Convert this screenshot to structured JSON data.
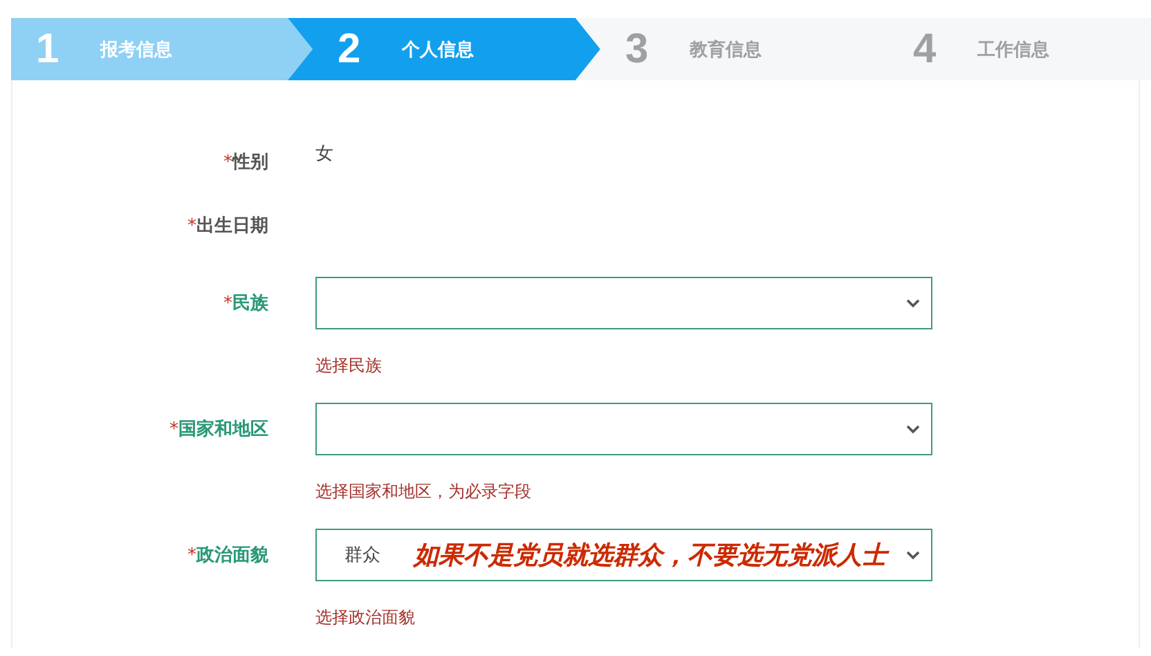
{
  "steps": [
    {
      "number": "1",
      "label": "报考信息",
      "completed": true,
      "selected": false
    },
    {
      "number": "2",
      "label": "个人信息",
      "completed": false,
      "selected": true
    },
    {
      "number": "3",
      "label": "教育信息",
      "completed": false,
      "selected": false
    },
    {
      "number": "4",
      "label": "工作信息",
      "completed": false,
      "selected": false
    }
  ],
  "fields": [
    {
      "label": "性别",
      "marker": "*",
      "kind": "static",
      "value": "女"
    },
    {
      "label": "出生日期",
      "marker": "*",
      "kind": "static"
    },
    {
      "label": "民族",
      "marker": "*",
      "kind": "select",
      "hint": "选择民族"
    },
    {
      "label": "国家和地区",
      "marker": "*",
      "kind": "select",
      "hint": "选择国家和地区，为必录字段"
    },
    {
      "label": "政治面貌",
      "marker": "*",
      "kind": "select",
      "value": "群众",
      "hint": "选择政治面貌",
      "annotation": "如果不是党员就选群众，不要选无党派人士"
    }
  ]
}
